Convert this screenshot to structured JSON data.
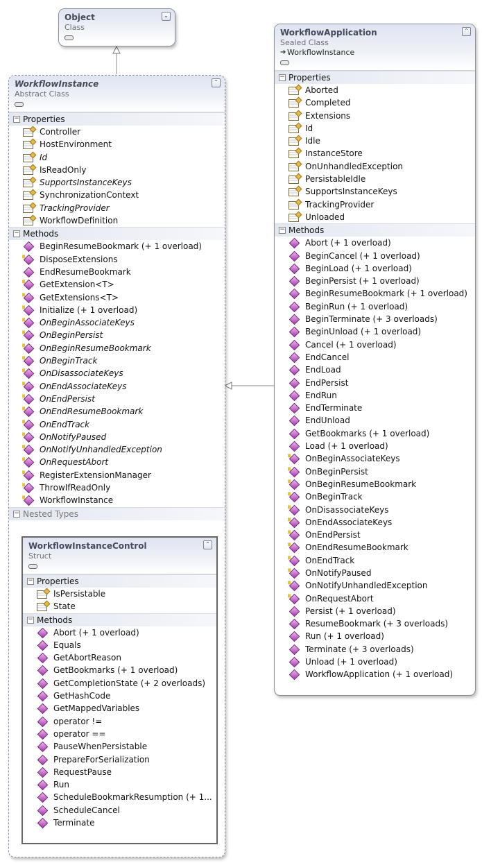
{
  "object_class": {
    "name": "Object",
    "kind": "Class"
  },
  "workflow_instance": {
    "name": "WorkflowInstance",
    "kind": "Abstract Class",
    "properties_label": "Properties",
    "properties": [
      {
        "name": "Controller",
        "italic": false
      },
      {
        "name": "HostEnvironment",
        "italic": false
      },
      {
        "name": "Id",
        "italic": true
      },
      {
        "name": "IsReadOnly",
        "italic": false
      },
      {
        "name": "SupportsInstanceKeys",
        "italic": true
      },
      {
        "name": "SynchronizationContext",
        "italic": false
      },
      {
        "name": "TrackingProvider",
        "italic": true
      },
      {
        "name": "WorkflowDefinition",
        "italic": false
      }
    ],
    "methods_label": "Methods",
    "methods": [
      {
        "name": "BeginResumeBookmark (+ 1 overload)",
        "italic": false,
        "protected": false
      },
      {
        "name": "DisposeExtensions",
        "italic": false,
        "protected": true
      },
      {
        "name": "EndResumeBookmark",
        "italic": false,
        "protected": false
      },
      {
        "name": "GetExtension<T>",
        "italic": false,
        "protected": true
      },
      {
        "name": "GetExtensions<T>",
        "italic": false,
        "protected": true
      },
      {
        "name": "Initialize (+ 1 overload)",
        "italic": false,
        "protected": true
      },
      {
        "name": "OnBeginAssociateKeys",
        "italic": true,
        "protected": true
      },
      {
        "name": "OnBeginPersist",
        "italic": true,
        "protected": true
      },
      {
        "name": "OnBeginResumeBookmark",
        "italic": true,
        "protected": true
      },
      {
        "name": "OnBeginTrack",
        "italic": true,
        "protected": true
      },
      {
        "name": "OnDisassociateKeys",
        "italic": true,
        "protected": true
      },
      {
        "name": "OnEndAssociateKeys",
        "italic": true,
        "protected": true
      },
      {
        "name": "OnEndPersist",
        "italic": true,
        "protected": true
      },
      {
        "name": "OnEndResumeBookmark",
        "italic": true,
        "protected": true
      },
      {
        "name": "OnEndTrack",
        "italic": true,
        "protected": true
      },
      {
        "name": "OnNotifyPaused",
        "italic": true,
        "protected": true
      },
      {
        "name": "OnNotifyUnhandledException",
        "italic": true,
        "protected": true
      },
      {
        "name": "OnRequestAbort",
        "italic": true,
        "protected": true
      },
      {
        "name": "RegisterExtensionManager",
        "italic": false,
        "protected": true
      },
      {
        "name": "ThrowIfReadOnly",
        "italic": false,
        "protected": true
      },
      {
        "name": "WorkflowInstance",
        "italic": false,
        "protected": true
      }
    ],
    "nested_label": "Nested Types"
  },
  "workflow_instance_control": {
    "name": "WorkflowInstanceControl",
    "kind": "Struct",
    "properties_label": "Properties",
    "properties": [
      {
        "name": "IsPersistable",
        "italic": false
      },
      {
        "name": "State",
        "italic": false
      }
    ],
    "methods_label": "Methods",
    "methods": [
      {
        "name": "Abort (+ 1 overload)",
        "italic": false,
        "protected": false
      },
      {
        "name": "Equals",
        "italic": false,
        "protected": false
      },
      {
        "name": "GetAbortReason",
        "italic": false,
        "protected": false
      },
      {
        "name": "GetBookmarks (+ 1 overload)",
        "italic": false,
        "protected": false
      },
      {
        "name": "GetCompletionState (+ 2 overloads)",
        "italic": false,
        "protected": false
      },
      {
        "name": "GetHashCode",
        "italic": false,
        "protected": false
      },
      {
        "name": "GetMappedVariables",
        "italic": false,
        "protected": false
      },
      {
        "name": "operator !=",
        "italic": false,
        "protected": false
      },
      {
        "name": "operator ==",
        "italic": false,
        "protected": false
      },
      {
        "name": "PauseWhenPersistable",
        "italic": false,
        "protected": false
      },
      {
        "name": "PrepareForSerialization",
        "italic": false,
        "protected": false
      },
      {
        "name": "RequestPause",
        "italic": false,
        "protected": false
      },
      {
        "name": "Run",
        "italic": false,
        "protected": false
      },
      {
        "name": "ScheduleBookmarkResumption (+ 1...",
        "italic": false,
        "protected": false
      },
      {
        "name": "ScheduleCancel",
        "italic": false,
        "protected": false
      },
      {
        "name": "Terminate",
        "italic": false,
        "protected": false
      }
    ]
  },
  "workflow_application": {
    "name": "WorkflowApplication",
    "kind": "Sealed Class",
    "inherits": "WorkflowInstance",
    "properties_label": "Properties",
    "properties": [
      {
        "name": "Aborted",
        "italic": false
      },
      {
        "name": "Completed",
        "italic": false
      },
      {
        "name": "Extensions",
        "italic": false
      },
      {
        "name": "Id",
        "italic": false
      },
      {
        "name": "Idle",
        "italic": false
      },
      {
        "name": "InstanceStore",
        "italic": false
      },
      {
        "name": "OnUnhandledException",
        "italic": false
      },
      {
        "name": "PersistableIdle",
        "italic": false
      },
      {
        "name": "SupportsInstanceKeys",
        "italic": false
      },
      {
        "name": "TrackingProvider",
        "italic": false
      },
      {
        "name": "Unloaded",
        "italic": false
      }
    ],
    "methods_label": "Methods",
    "methods": [
      {
        "name": "Abort (+ 1 overload)",
        "italic": false,
        "protected": false
      },
      {
        "name": "BeginCancel (+ 1 overload)",
        "italic": false,
        "protected": false
      },
      {
        "name": "BeginLoad (+ 1 overload)",
        "italic": false,
        "protected": false
      },
      {
        "name": "BeginPersist (+ 1 overload)",
        "italic": false,
        "protected": false
      },
      {
        "name": "BeginResumeBookmark (+ 1 overload)",
        "italic": false,
        "protected": false
      },
      {
        "name": "BeginRun (+ 1 overload)",
        "italic": false,
        "protected": false
      },
      {
        "name": "BeginTerminate (+ 3 overloads)",
        "italic": false,
        "protected": false
      },
      {
        "name": "BeginUnload (+ 1 overload)",
        "italic": false,
        "protected": false
      },
      {
        "name": "Cancel (+ 1 overload)",
        "italic": false,
        "protected": false
      },
      {
        "name": "EndCancel",
        "italic": false,
        "protected": false
      },
      {
        "name": "EndLoad",
        "italic": false,
        "protected": false
      },
      {
        "name": "EndPersist",
        "italic": false,
        "protected": false
      },
      {
        "name": "EndRun",
        "italic": false,
        "protected": false
      },
      {
        "name": "EndTerminate",
        "italic": false,
        "protected": false
      },
      {
        "name": "EndUnload",
        "italic": false,
        "protected": false
      },
      {
        "name": "GetBookmarks (+ 1 overload)",
        "italic": false,
        "protected": false
      },
      {
        "name": "Load (+ 1 overload)",
        "italic": false,
        "protected": false
      },
      {
        "name": "OnBeginAssociateKeys",
        "italic": false,
        "protected": true
      },
      {
        "name": "OnBeginPersist",
        "italic": false,
        "protected": true
      },
      {
        "name": "OnBeginResumeBookmark",
        "italic": false,
        "protected": true
      },
      {
        "name": "OnBeginTrack",
        "italic": false,
        "protected": true
      },
      {
        "name": "OnDisassociateKeys",
        "italic": false,
        "protected": true
      },
      {
        "name": "OnEndAssociateKeys",
        "italic": false,
        "protected": true
      },
      {
        "name": "OnEndPersist",
        "italic": false,
        "protected": true
      },
      {
        "name": "OnEndResumeBookmark",
        "italic": false,
        "protected": true
      },
      {
        "name": "OnEndTrack",
        "italic": false,
        "protected": true
      },
      {
        "name": "OnNotifyPaused",
        "italic": false,
        "protected": true
      },
      {
        "name": "OnNotifyUnhandledException",
        "italic": false,
        "protected": true
      },
      {
        "name": "OnRequestAbort",
        "italic": false,
        "protected": true
      },
      {
        "name": "Persist (+ 1 overload)",
        "italic": false,
        "protected": false
      },
      {
        "name": "ResumeBookmark (+ 3 overloads)",
        "italic": false,
        "protected": false
      },
      {
        "name": "Run (+ 1 overload)",
        "italic": false,
        "protected": false
      },
      {
        "name": "Terminate (+ 3 overloads)",
        "italic": false,
        "protected": false
      },
      {
        "name": "Unload (+ 1 overload)",
        "italic": false,
        "protected": false
      },
      {
        "name": "WorkflowApplication (+ 1 overload)",
        "italic": false,
        "protected": false
      }
    ]
  }
}
